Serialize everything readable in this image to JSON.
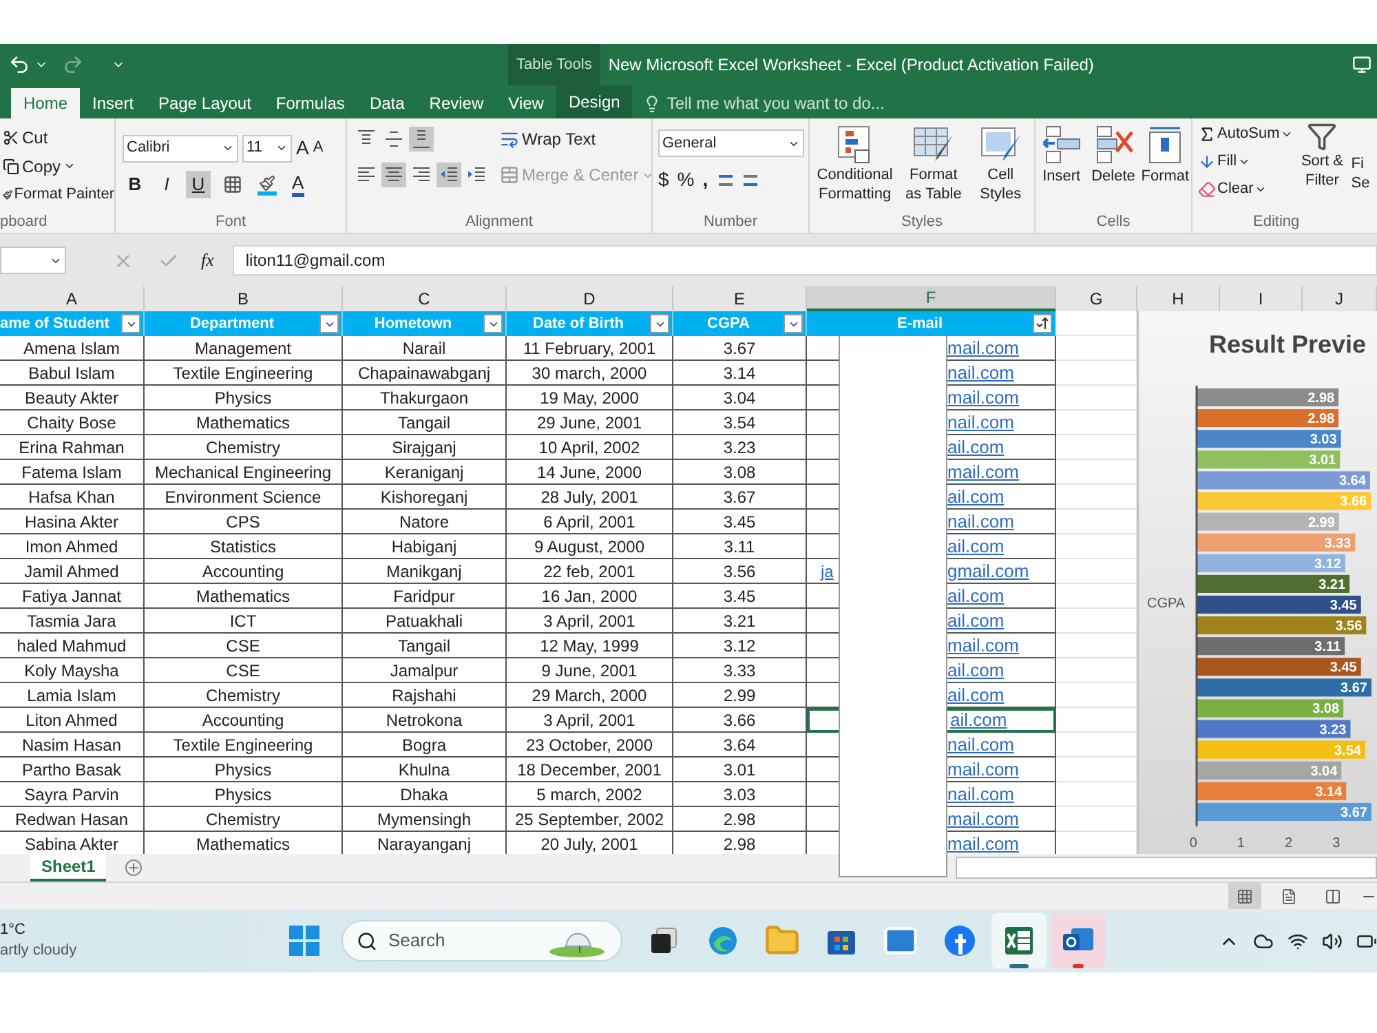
{
  "title_bar": {
    "context_label": "Table Tools",
    "title": "New Microsoft Excel Worksheet - Excel (Product Activation Failed)"
  },
  "ribbon_tabs": [
    {
      "label": "Home",
      "selected": true,
      "kind": "normal"
    },
    {
      "label": "Insert",
      "selected": false,
      "kind": "normal"
    },
    {
      "label": "Page Layout",
      "selected": false,
      "kind": "normal"
    },
    {
      "label": "Formulas",
      "selected": false,
      "kind": "normal"
    },
    {
      "label": "Data",
      "selected": false,
      "kind": "normal"
    },
    {
      "label": "Review",
      "selected": false,
      "kind": "normal"
    },
    {
      "label": "View",
      "selected": false,
      "kind": "normal"
    },
    {
      "label": "Design",
      "selected": false,
      "kind": "contextual"
    }
  ],
  "tell_me": {
    "placeholder": "Tell me what you want to do..."
  },
  "ribbon": {
    "clipboard": {
      "cut": "Cut",
      "copy": "Copy",
      "format_painter": "Format Painter",
      "label": "pboard"
    },
    "font": {
      "name": "Calibri",
      "size": "11",
      "grow": "A",
      "shrink": "A",
      "bold": {
        "label": "B",
        "on": false
      },
      "italic": {
        "label": "I",
        "on": false
      },
      "underline": {
        "label": "U",
        "on": true
      },
      "font_color": "A",
      "label": "Font"
    },
    "alignment": {
      "buttons": [
        {
          "kind": "top",
          "on": false
        },
        {
          "kind": "middle",
          "on": false
        },
        {
          "kind": "bottom",
          "on": true
        },
        {
          "kind": "left",
          "on": false
        },
        {
          "kind": "center",
          "on": true
        },
        {
          "kind": "right",
          "on": false
        },
        {
          "kind": "outdent",
          "on": true
        },
        {
          "kind": "indent",
          "on": false
        }
      ],
      "wrap_text": "Wrap Text",
      "merge_center": "Merge & Center",
      "label": "Alignment"
    },
    "number": {
      "format": "General",
      "currency": "$",
      "percent": "%",
      "comma": ",",
      "label": "Number"
    },
    "styles": {
      "buttons": [
        {
          "kind": "conditional",
          "label": "Conditional Formatting"
        },
        {
          "kind": "table",
          "label": "Format as Table"
        },
        {
          "kind": "cellstyles",
          "label": "Cell Styles"
        }
      ],
      "label": "Styles"
    },
    "cells": {
      "buttons": [
        {
          "kind": "insert",
          "label": "Insert"
        },
        {
          "kind": "delete",
          "label": "Delete"
        },
        {
          "kind": "format",
          "label": "Format"
        }
      ],
      "label": "Cells"
    },
    "editing": {
      "autosum": "AutoSum",
      "fill": "Fill",
      "clear": "Clear",
      "sort_filter": "Sort & Filter",
      "find_select": [
        "Fi",
        "Se"
      ],
      "label": "Editing"
    }
  },
  "formula_bar": {
    "function_label": "fx",
    "value": "liton11@gmail.com"
  },
  "columns": [
    {
      "letter": "A",
      "selected": false
    },
    {
      "letter": "B",
      "selected": false
    },
    {
      "letter": "C",
      "selected": false
    },
    {
      "letter": "D",
      "selected": false
    },
    {
      "letter": "E",
      "selected": false
    },
    {
      "letter": "F",
      "selected": true
    },
    {
      "letter": "G",
      "selected": false
    },
    {
      "letter": "H",
      "selected": false
    },
    {
      "letter": "I",
      "selected": false
    },
    {
      "letter": "J",
      "selected": false
    }
  ],
  "table": {
    "headers": [
      {
        "label": "ame of Student",
        "kind": "filter"
      },
      {
        "label": "Department",
        "kind": "filter"
      },
      {
        "label": "Hometown",
        "kind": "filter"
      },
      {
        "label": "Date of Birth",
        "kind": "filter"
      },
      {
        "label": "CGPA",
        "kind": "filter"
      },
      {
        "label": "E-mail",
        "kind": "sorted"
      }
    ],
    "rows": [
      {
        "name": "Amena Islam",
        "department": "Management",
        "hometown": "Narail",
        "dob": "11 February, 2001",
        "cgpa": "3.67",
        "email_end": "mail.com",
        "selected": false
      },
      {
        "name": "Babul Islam",
        "department": "Textile Engineering",
        "hometown": "Chapainawabganj",
        "dob": "30 march, 2000",
        "cgpa": "3.14",
        "email_end": "nail.com",
        "selected": false
      },
      {
        "name": "Beauty Akter",
        "department": "Physics",
        "hometown": "Thakurgaon",
        "dob": "19 May, 2000",
        "cgpa": "3.04",
        "email_end": "mail.com",
        "selected": false
      },
      {
        "name": "Chaity Bose",
        "department": "Mathematics",
        "hometown": "Tangail",
        "dob": "29 June, 2001",
        "cgpa": "3.54",
        "email_end": "nail.com",
        "selected": false
      },
      {
        "name": "Erina Rahman",
        "department": "Chemistry",
        "hometown": "Sirajganj",
        "dob": "10 April, 2002",
        "cgpa": "3.23",
        "email_end": "ail.com",
        "selected": false
      },
      {
        "name": "Fatema Islam",
        "department": "Mechanical Engineering",
        "hometown": "Keraniganj",
        "dob": "14 June, 2000",
        "cgpa": "3.08",
        "email_end": "mail.com",
        "selected": false
      },
      {
        "name": "Hafsa Khan",
        "department": "Environment Science",
        "hometown": "Kishoreganj",
        "dob": "28 July, 2001",
        "cgpa": "3.67",
        "email_end": "ail.com",
        "selected": false
      },
      {
        "name": "Hasina Akter",
        "department": "CPS",
        "hometown": "Natore",
        "dob": "6 April, 2001",
        "cgpa": "3.45",
        "email_end": "nail.com",
        "selected": false
      },
      {
        "name": "Imon Ahmed",
        "department": "Statistics",
        "hometown": "Habiganj",
        "dob": "9 August, 2000",
        "cgpa": "3.11",
        "email_end": "ail.com",
        "selected": false
      },
      {
        "name": "Jamil Ahmed",
        "department": "Accounting",
        "hometown": "Manikganj",
        "dob": "22 feb, 2001",
        "cgpa": "3.56",
        "email_start": "ja",
        "email_end": "gmail.com",
        "selected": false
      },
      {
        "name": "Fatiya Jannat",
        "department": "Mathematics",
        "hometown": "Faridpur",
        "dob": "16 Jan, 2000",
        "cgpa": "3.45",
        "email_end": "ail.com",
        "selected": false
      },
      {
        "name": "Tasmia Jara",
        "department": "ICT",
        "hometown": "Patuakhali",
        "dob": "3 April, 2001",
        "cgpa": "3.21",
        "email_end": "ail.com",
        "selected": false
      },
      {
        "name": "haled Mahmud",
        "department": "CSE",
        "hometown": "Tangail",
        "dob": "12 May, 1999",
        "cgpa": "3.12",
        "email_end": "mail.com",
        "selected": false
      },
      {
        "name": "Koly Maysha",
        "department": "CSE",
        "hometown": "Jamalpur",
        "dob": "9 June, 2001",
        "cgpa": "3.33",
        "email_end": "ail.com",
        "selected": false
      },
      {
        "name": "Lamia Islam",
        "department": "Chemistry",
        "hometown": "Rajshahi",
        "dob": "29 March, 2000",
        "cgpa": "2.99",
        "email_end": "ail.com",
        "selected": false
      },
      {
        "name": "Liton Ahmed",
        "department": "Accounting",
        "hometown": "Netrokona",
        "dob": "3 April, 2001",
        "cgpa": "3.66",
        "email_end": "ail.com",
        "selected": true
      },
      {
        "name": "Nasim Hasan",
        "department": "Textile Engineering",
        "hometown": "Bogra",
        "dob": "23 October, 2000",
        "cgpa": "3.64",
        "email_end": "nail.com",
        "selected": false
      },
      {
        "name": "Partho Basak",
        "department": "Physics",
        "hometown": "Khulna",
        "dob": "18 December, 2001",
        "cgpa": "3.01",
        "email_end": "mail.com",
        "selected": false
      },
      {
        "name": "Sayra Parvin",
        "department": "Physics",
        "hometown": "Dhaka",
        "dob": "5 march, 2002",
        "cgpa": "3.03",
        "email_end": "nail.com",
        "selected": false
      },
      {
        "name": "Redwan Hasan",
        "department": "Chemistry",
        "hometown": "Mymensingh",
        "dob": "25 September, 2002",
        "cgpa": "2.98",
        "email_end": "mail.com",
        "selected": false
      },
      {
        "name": "Sabina Akter",
        "department": "Mathematics",
        "hometown": "Narayanganj",
        "dob": "20 July, 2001",
        "cgpa": "2.98",
        "email_end": "mail.com",
        "selected": false
      }
    ]
  },
  "chart": {
    "chart_data": {
      "type": "bar",
      "orientation": "horizontal",
      "title": "Result Previe",
      "xlim": [
        0,
        3.7
      ],
      "series": [
        {
          "name": "CGPA",
          "values": [
            2.98,
            2.98,
            3.03,
            3.01,
            3.64,
            3.66,
            2.99,
            3.33,
            3.12,
            3.21,
            3.45,
            3.56,
            3.11,
            3.45,
            3.67,
            3.08,
            3.23,
            3.54,
            3.04,
            3.14,
            3.67
          ]
        }
      ],
      "xticks": [
        0,
        1,
        2,
        3
      ],
      "data_labels": true
    }
  },
  "sheet_tabs": [
    {
      "label": "Sheet1",
      "selected": true
    }
  ],
  "status_bar": {
    "views": [
      {
        "kind": "normal",
        "selected": true
      },
      {
        "kind": "page_layout",
        "selected": false
      },
      {
        "kind": "page_break",
        "selected": false
      }
    ]
  },
  "taskbar": {
    "temperature": "1°C",
    "weather": "artly cloudy",
    "search_placeholder": "Search",
    "apps": [
      {
        "kind": "taskview",
        "active": false
      },
      {
        "kind": "browser",
        "active": false
      },
      {
        "kind": "folder",
        "active": false
      },
      {
        "kind": "store",
        "active": false
      },
      {
        "kind": "mail",
        "active": false
      },
      {
        "kind": "social",
        "active": false
      },
      {
        "kind": "sheet",
        "active": true
      },
      {
        "kind": "outlook",
        "active": false,
        "badge": true
      }
    ]
  }
}
